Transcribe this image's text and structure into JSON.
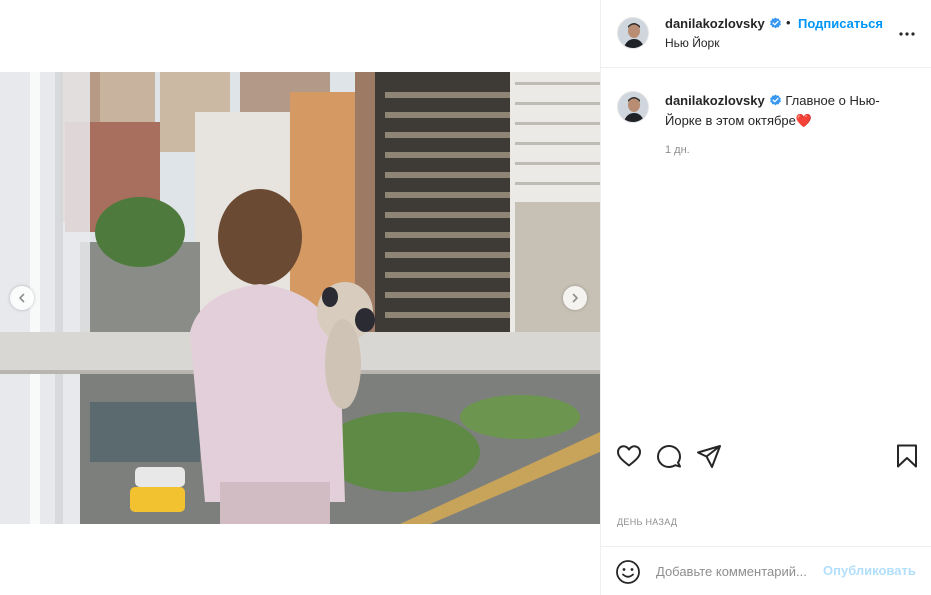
{
  "post": {
    "username": "danilakozlovsky",
    "verified": true,
    "follow_label": "Подписаться",
    "separator": "•",
    "location": "Нью Йорк",
    "caption_text": "Главное о Нью-Йорке в этом октябре",
    "caption_emoji": "❤️",
    "caption_time": "1 дн.",
    "date_ago": "ДЕНЬ НАЗАД"
  },
  "comment": {
    "placeholder": "Добавьте комментарий...",
    "post_label": "Опубликовать"
  },
  "icons": {
    "verified": "verified-badge-icon",
    "more": "more-options-icon",
    "like": "heart-icon",
    "comment": "comment-bubble-icon",
    "share": "paper-plane-icon",
    "save": "bookmark-icon",
    "emoji": "smiley-icon",
    "prev": "chevron-left-icon",
    "next": "chevron-right-icon"
  },
  "colors": {
    "accent": "#0095f6",
    "accent_disabled": "#b2dffc",
    "text": "#262626",
    "muted": "#8e8e8e",
    "heart": "#ed4956"
  },
  "media": {
    "type": "photo",
    "carousel": true
  }
}
